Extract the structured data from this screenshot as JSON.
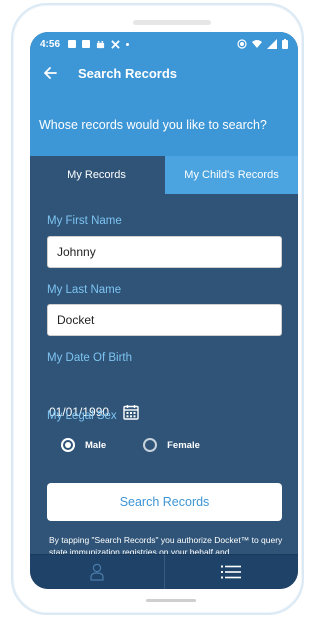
{
  "status_bar": {
    "time": "4:56"
  },
  "app_bar": {
    "title": "Search Records"
  },
  "prompt": "Whose records would you like to search?",
  "tabs": [
    {
      "label": "My Records",
      "active": true
    },
    {
      "label": "My Child's Records",
      "active": false
    }
  ],
  "form": {
    "first_name_label": "My First Name",
    "first_name_value": "Johnny",
    "last_name_label": "My Last Name",
    "last_name_value": "Docket",
    "dob_label": "My Date Of Birth",
    "dob_value": "01/01/1990",
    "sex_label": "My Legal Sex",
    "sex_options": [
      {
        "label": "Male",
        "selected": true
      },
      {
        "label": "Female",
        "selected": false
      }
    ]
  },
  "search_button_label": "Search Records",
  "disclaimer": "By tapping \"Search Records\" you authorize Docket™ to query state immunization registries on your behalf and",
  "colors": {
    "primary_blue": "#3d96d6",
    "navy": "#2f5478",
    "label_blue": "#7ec4f2",
    "bottom_nav": "#1f4368"
  },
  "icons": {
    "back": "arrow-left-icon",
    "calendar": "calendar-icon",
    "nav_profile": "person-icon",
    "nav_menu": "list-icon"
  }
}
